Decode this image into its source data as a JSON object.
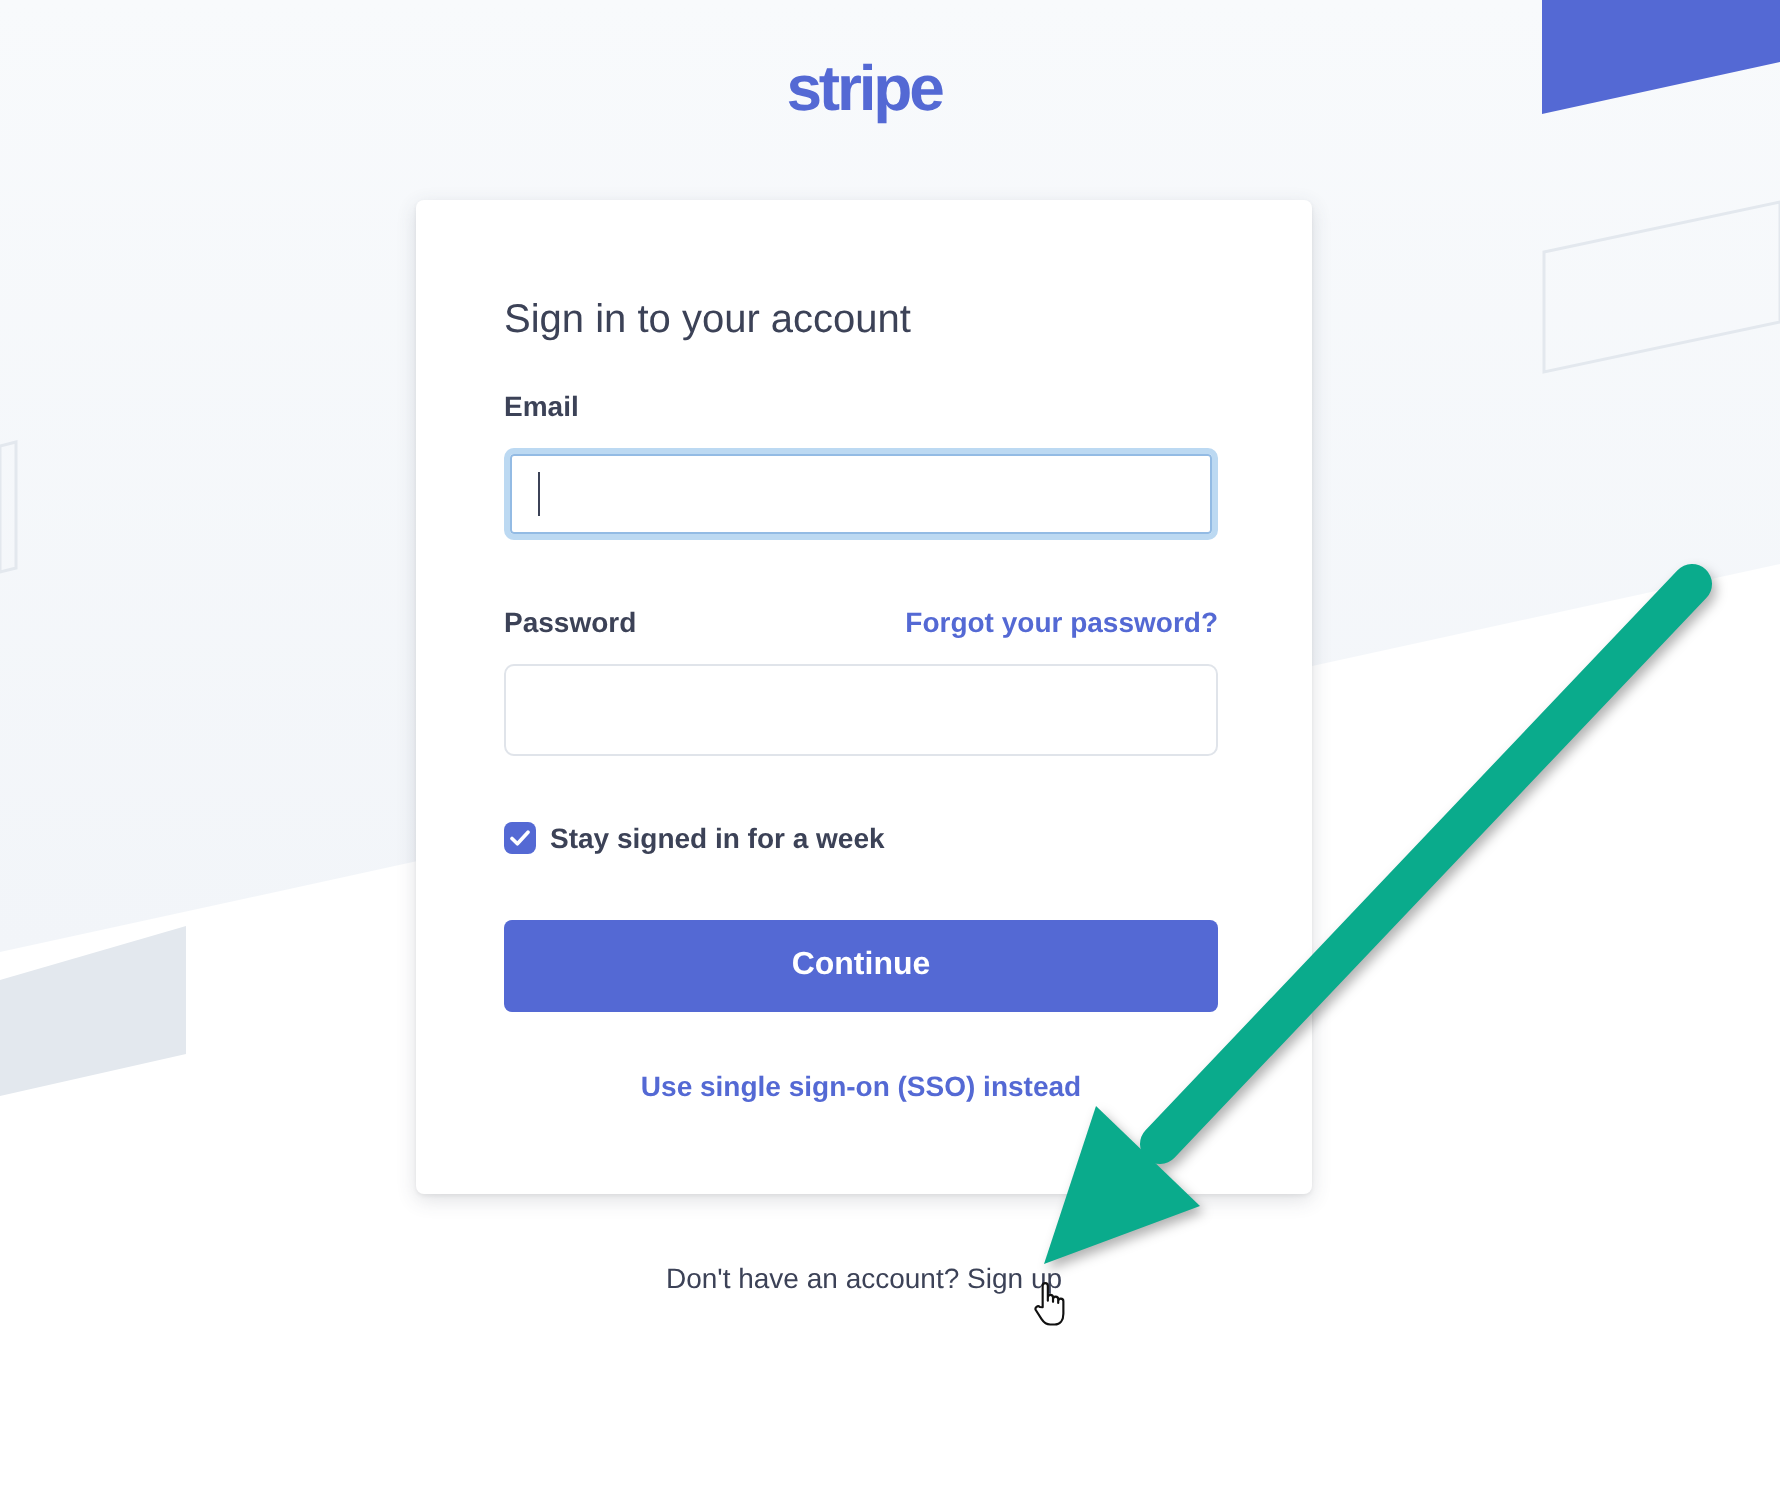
{
  "logo": "stripe",
  "card": {
    "title": "Sign in to your account",
    "fields": [
      {
        "label": "Email",
        "focused": true
      },
      {
        "label": "Password",
        "link": "Forgot your password?",
        "focused": false
      }
    ],
    "remember": {
      "label": "Stay signed in for a week",
      "checked": true
    },
    "submit": "Continue",
    "sso_link": "Use single sign-on (SSO) instead"
  },
  "footer": {
    "prompt": "Don't have an account?",
    "link": "Sign up"
  }
}
